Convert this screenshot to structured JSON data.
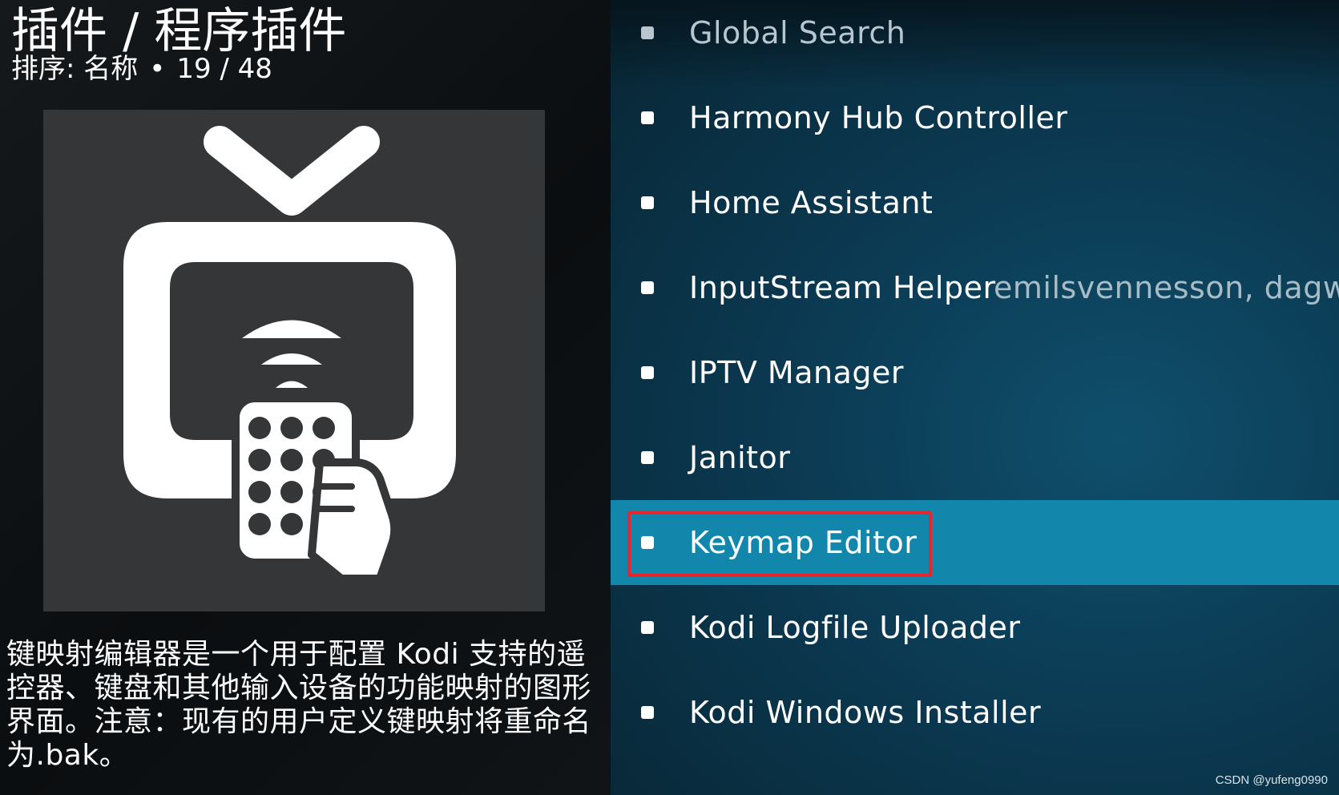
{
  "header": {
    "title": "插件 / 程序插件",
    "sort_label": "排序: 名称",
    "separator": "•",
    "position": "19 / 48"
  },
  "addon": {
    "icon": "tv-remote-icon",
    "description": "键映射编辑器是一个用于配置 Kodi 支持的遥控器、键盘和其他输入设备的功能映射的图形界面。注意：现有的用户定义键映射将重命名为.bak。"
  },
  "list": {
    "items": [
      {
        "label": "Global Search"
      },
      {
        "label": "Harmony Hub Controller"
      },
      {
        "label": "Home Assistant"
      },
      {
        "label": "InputStream Helper",
        "author": "emilsvennesson, dagwieers"
      },
      {
        "label": "IPTV Manager"
      },
      {
        "label": "Janitor"
      },
      {
        "label": "Keymap Editor",
        "selected": true
      },
      {
        "label": "Kodi Logfile Uploader"
      },
      {
        "label": "Kodi Windows Installer"
      }
    ]
  },
  "colors": {
    "selected_row": "#1287ab",
    "highlight_border": "#e8252a",
    "list_background": "#0b3850"
  },
  "watermark": "CSDN @yufeng0990"
}
